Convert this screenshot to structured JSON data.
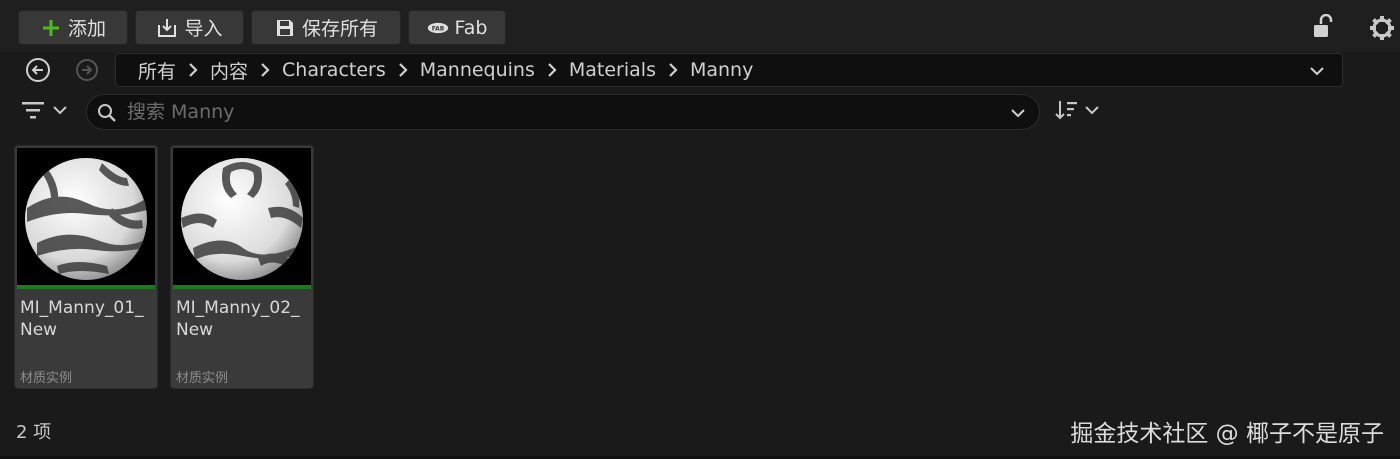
{
  "toolbar": {
    "add_label": "添加",
    "import_label": "导入",
    "save_all_label": "保存所有",
    "fab_label": "Fab"
  },
  "breadcrumb": {
    "items": [
      "所有",
      "内容",
      "Characters",
      "Mannequins",
      "Materials",
      "Manny"
    ]
  },
  "search": {
    "placeholder": "搜索 Manny",
    "value": ""
  },
  "assets": [
    {
      "name": "MI_Manny_01_New",
      "name_line1": "MI_Manny_01_",
      "name_line2": "New",
      "type": "材质实例"
    },
    {
      "name": "MI_Manny_02_New",
      "name_line1": "MI_Manny_02_",
      "name_line2": "New",
      "type": "材质实例"
    }
  ],
  "status": {
    "item_count": "2 项"
  },
  "watermark": "掘金技术社区 @ 椰子不是原子",
  "icons": {
    "add": "plus-icon",
    "import": "import-icon",
    "save": "save-icon",
    "fab": "fab-icon",
    "lock": "unlock-icon",
    "settings": "gear-icon",
    "back": "back-arrow-icon",
    "forward": "forward-arrow-icon",
    "filter": "filter-icon",
    "search": "search-icon",
    "sort": "sort-icon"
  },
  "colors": {
    "add_icon": "#4cbb17",
    "asset_type_strip": "#1e7a1e",
    "panel_bg": "#1a1a1a",
    "field_bg": "#0f0f0f",
    "tile_bg": "#3a3a3a"
  }
}
